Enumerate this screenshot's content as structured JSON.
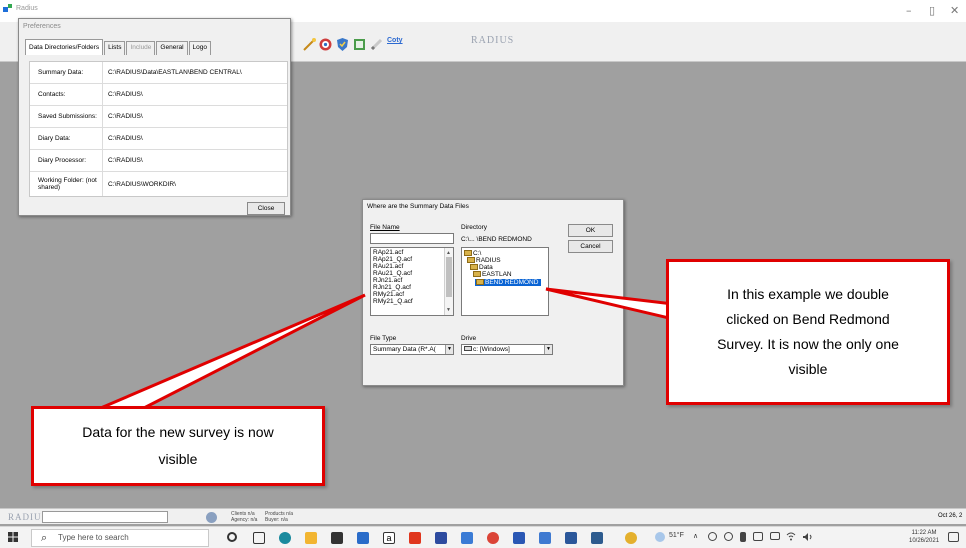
{
  "app": {
    "title": "Radius",
    "logo_text": "RADIUS",
    "coty_label": "Coty"
  },
  "preferences": {
    "title": "Preferences",
    "tabs": [
      "Data Directories/Folders",
      "Lists",
      "Include",
      "General",
      "Logo"
    ],
    "rows": [
      {
        "label": "Summary Data:",
        "value": "C:\\RADIUS\\Data\\EASTLAN\\BEND CENTRAL\\"
      },
      {
        "label": "Contacts:",
        "value": "C:\\RADIUS\\"
      },
      {
        "label": "Saved Submissions:",
        "value": "C:\\RADIUS\\"
      },
      {
        "label": "Diary Data:",
        "value": "C:\\RADIUS\\"
      },
      {
        "label": "Diary Processor:",
        "value": "C:\\RADIUS\\"
      },
      {
        "label": "Working Folder: (not shared)",
        "value": "C:\\RADIUS\\WORKDIR\\"
      }
    ],
    "close_label": "Close"
  },
  "summary_dialog": {
    "title": "Where are the Summary Data Files",
    "file_name_label": "File Name",
    "file_name_value": "",
    "files": [
      "RAp21.acf",
      "RAp21_Q.acf",
      "RAu21.acf",
      "RAu21_Q.acf",
      "RJn21.acf",
      "RJn21_Q.acf",
      "RMy21.acf",
      "RMy21_Q.acf"
    ],
    "directory_label": "Directory",
    "directory_path": "C:\\... \\BEND REDMOND",
    "directories": [
      "C:\\",
      "RADIUS",
      "Data",
      "EASTLAN",
      "BEND REDMOND"
    ],
    "selected_directory": "BEND REDMOND",
    "ok_label": "OK",
    "cancel_label": "Cancel",
    "file_type_label": "File Type",
    "file_type_value": "Summary Data (R*.A(",
    "drive_label": "Drive",
    "drive_value": "c: [Windows]"
  },
  "callouts": {
    "right": "In this example we double clicked on Bend Redmond Survey. It is now the only one visible",
    "left": "Data for the new survey is now visible"
  },
  "statusbar": {
    "clients": "Clients n/a",
    "agency": "Agency: n/a",
    "products": "Products n/a",
    "buyer": "Buyer: n/a",
    "date": "Oct 26, 2"
  },
  "taskbar": {
    "search_placeholder": "Type here to search",
    "weather": "51°F",
    "time": "11:22 AM",
    "date": "10/26/2021"
  },
  "colors": {
    "callout_border": "#e00000",
    "selection": "#0a64d4",
    "desktop": "#a0a0a0"
  }
}
